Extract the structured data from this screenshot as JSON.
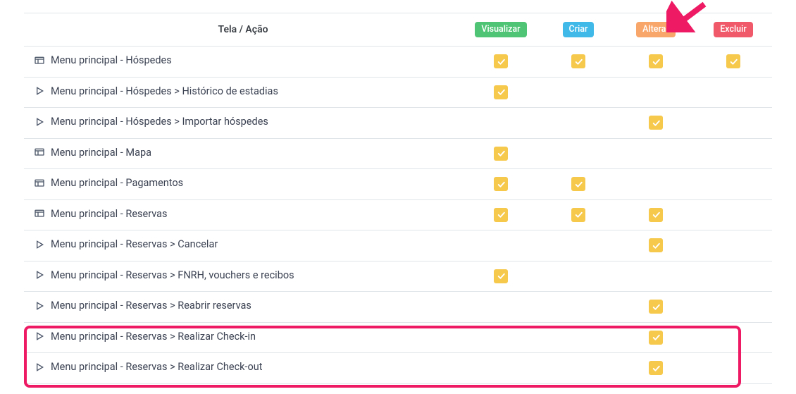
{
  "header": {
    "label_col": "Tela / Ação",
    "actions": {
      "visualizar": "Visualizar",
      "criar": "Criar",
      "alterar": "Alterar",
      "excluir": "Excluir"
    }
  },
  "rows": [
    {
      "icon": "screen",
      "label": "Menu principal - Hóspedes",
      "visualizar": true,
      "criar": true,
      "alterar": true,
      "excluir": true
    },
    {
      "icon": "play",
      "label": "Menu principal - Hóspedes > Histórico de estadias",
      "visualizar": true,
      "criar": false,
      "alterar": false,
      "excluir": false
    },
    {
      "icon": "play",
      "label": "Menu principal - Hóspedes > Importar hóspedes",
      "visualizar": false,
      "criar": false,
      "alterar": true,
      "excluir": false
    },
    {
      "icon": "screen",
      "label": "Menu principal - Mapa",
      "visualizar": true,
      "criar": false,
      "alterar": false,
      "excluir": false
    },
    {
      "icon": "screen",
      "label": "Menu principal - Pagamentos",
      "visualizar": true,
      "criar": true,
      "alterar": false,
      "excluir": false
    },
    {
      "icon": "screen",
      "label": "Menu principal - Reservas",
      "visualizar": true,
      "criar": true,
      "alterar": true,
      "excluir": false
    },
    {
      "icon": "play",
      "label": "Menu principal - Reservas > Cancelar",
      "visualizar": false,
      "criar": false,
      "alterar": true,
      "excluir": false
    },
    {
      "icon": "play",
      "label": "Menu principal - Reservas > FNRH, vouchers e recibos",
      "visualizar": true,
      "criar": false,
      "alterar": false,
      "excluir": false
    },
    {
      "icon": "play",
      "label": "Menu principal - Reservas > Reabrir reservas",
      "visualizar": false,
      "criar": false,
      "alterar": true,
      "excluir": false
    },
    {
      "icon": "play",
      "label": "Menu principal - Reservas > Realizar Check-in",
      "visualizar": false,
      "criar": false,
      "alterar": true,
      "excluir": false
    },
    {
      "icon": "play",
      "label": "Menu principal - Reservas > Realizar Check-out",
      "visualizar": false,
      "criar": false,
      "alterar": true,
      "excluir": false
    }
  ]
}
